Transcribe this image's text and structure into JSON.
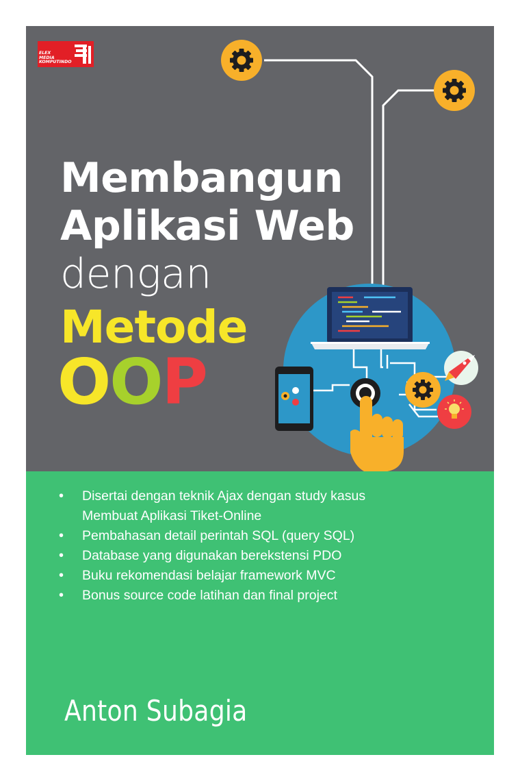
{
  "colors": {
    "page_background": "#ffffff",
    "top_background": "#636468",
    "bottom_background": "#3fc174",
    "title_white": "#ffffff",
    "metode_yellow": "#f7e629",
    "oop_letters": [
      "#f7e629",
      "#a7d12c",
      "#ef3e42"
    ],
    "logo_red": "#e21f26",
    "gear_orange": "#f8b02a",
    "circle_blue": "#2d97c8",
    "laptop_blue": "#26447c",
    "hand_yellow": "#f8b02a",
    "accent_red": "#ef3e42"
  },
  "publisher": {
    "logo_lines": [
      "ELEX",
      "MEDIA",
      "KOMPUTINDO"
    ]
  },
  "title": {
    "line1": "Membangun",
    "line2": "Aplikasi Web",
    "line3": "dengan",
    "highlight": "Metode",
    "oop_letters": [
      "O",
      "O",
      "P"
    ]
  },
  "illustration": {
    "icons": [
      "gear-icon",
      "gear-icon",
      "laptop-icon",
      "code-lines-icon",
      "smartphone-icon",
      "touch-button-icon",
      "pointing-hand-icon",
      "rocket-icon",
      "gear-icon",
      "lightbulb-icon"
    ]
  },
  "features": [
    "Disertai dengan teknik Ajax dengan study kasus Membuat Aplikasi Tiket-Online",
    "Pembahasan detail perintah SQL (query SQL)",
    "Database yang digunakan berekstensi PDO",
    "Buku rekomendasi belajar framework MVC",
    "Bonus source code latihan dan final project"
  ],
  "author": "Anton Subagia"
}
